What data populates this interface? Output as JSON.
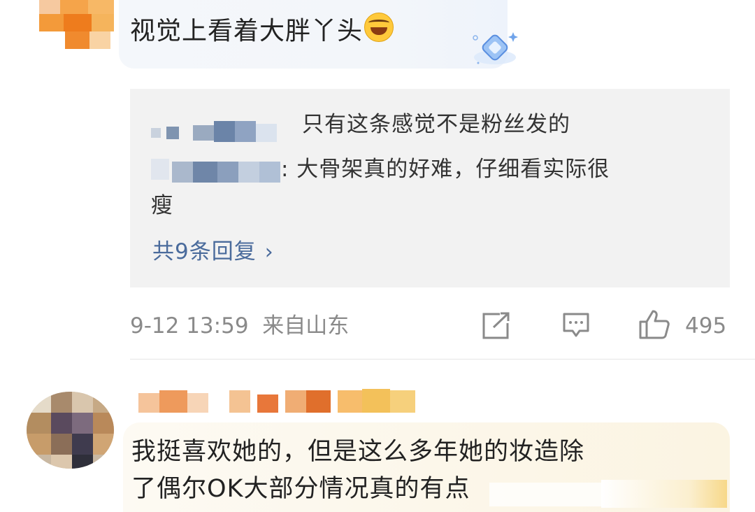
{
  "comment1": {
    "text": "视觉上看着大胖丫头",
    "emoji": "laughing-crying-emoji",
    "badge": "diamond-badge-icon"
  },
  "replies": {
    "items": [
      {
        "text": "只有这条感觉不是粉丝发的"
      },
      {
        "text": ": 大骨架真的好难，仔细看实际很"
      },
      {
        "text": "瘦"
      }
    ],
    "more_label": "共9条回复",
    "chevron": "chevron-right-icon"
  },
  "meta": {
    "datetime": "9-12 13:59",
    "location": "来自山东",
    "like_count": "495"
  },
  "comment2": {
    "line1": "我挺喜欢她的，但是这么多年她的妆造除",
    "line2": "了偶尔OK大部分情况真的有点"
  },
  "colors": {
    "link": "#4a6b9c",
    "meta": "#8a8a8a",
    "reply_bg": "#f2f2f2"
  }
}
